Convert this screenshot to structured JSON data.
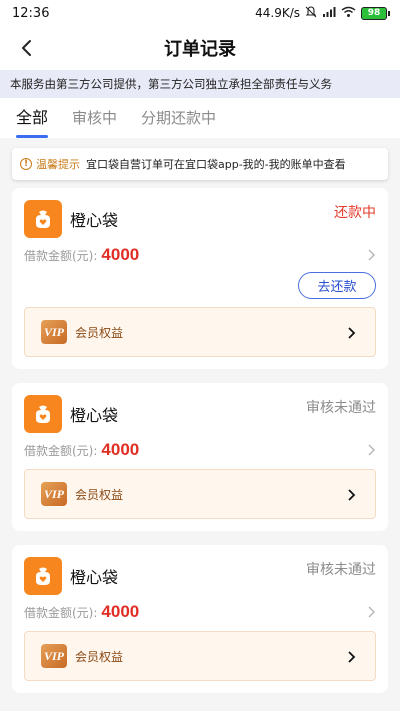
{
  "status_bar": {
    "time": "12:36",
    "speed": "44.9K/s",
    "battery": "98"
  },
  "nav": {
    "title": "订单记录"
  },
  "notice": "本服务由第三方公司提供，第三方公司独立承担全部责任与义务",
  "tabs": [
    {
      "label": "全部",
      "active": true
    },
    {
      "label": "审核中",
      "active": false
    },
    {
      "label": "分期还款中",
      "active": false
    }
  ],
  "tip": {
    "label": "温馨提示",
    "text": "宜口袋自营订单可在宜口袋app-我的-我的账单中查看"
  },
  "orders": [
    {
      "app_name": "橙心袋",
      "status": "还款中",
      "amount_label": "借款金额(元):",
      "amount": "4000",
      "repay_label": "去还款",
      "vip_label": "会员权益"
    },
    {
      "app_name": "橙心袋",
      "status": "审核未通过",
      "amount_label": "借款金额(元):",
      "amount": "4000",
      "vip_label": "会员权益"
    },
    {
      "app_name": "橙心袋",
      "status": "审核未通过",
      "amount_label": "借款金额(元):",
      "amount": "4000",
      "vip_label": "会员权益"
    }
  ],
  "colors": {
    "accent": "#3b6cf0",
    "brand_orange": "#f7861e",
    "amount_red": "#e02e24",
    "status_repaying": "#e43b2c",
    "status_rejected": "#8c8c8c"
  }
}
